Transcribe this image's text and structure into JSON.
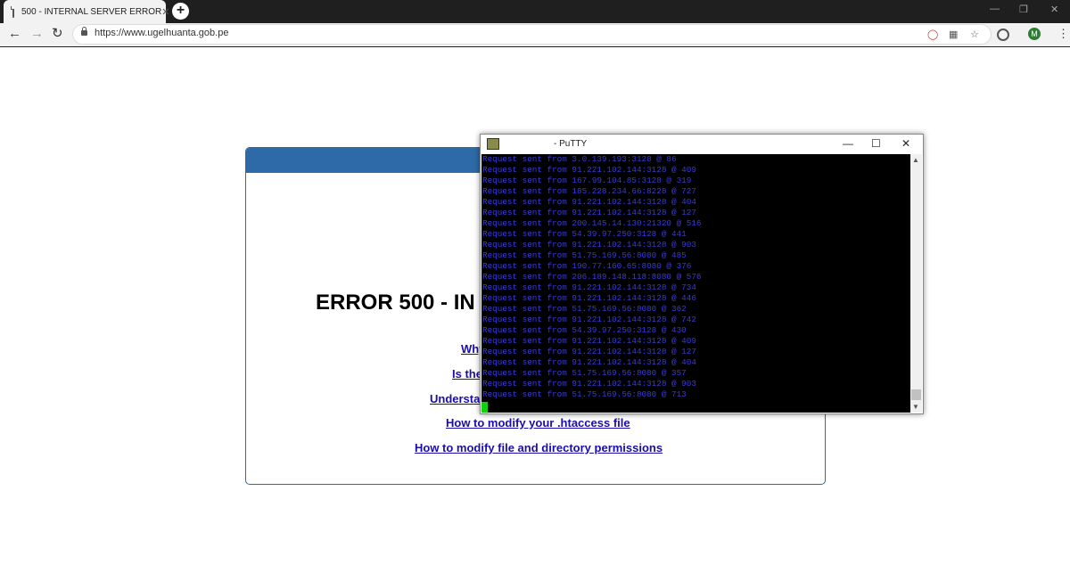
{
  "browser": {
    "tab_title": "500 - INTERNAL SERVER ERROR",
    "tab_close": "✕",
    "new_tab": "+",
    "url": "https://www.ugelhuanta.gob.pe",
    "profile_initial": "M"
  },
  "page": {
    "heading": "ERROR 500 - IN",
    "links": [
      "Why",
      "Is the",
      "Understa",
      "How to modify your .htaccess file",
      "How to modify file and directory permissions"
    ]
  },
  "putty": {
    "title": "- PuTTY",
    "lines": [
      "Request sent from 3.0.139.193:3128 @ 86",
      "Request sent from 91.221.102.144:3128 @ 409",
      "Request sent from 167.99.104.85:3128 @ 319",
      "Request sent from 185.228.234.66:8228 @ 727",
      "Request sent from 91.221.102.144:3128 @ 404",
      "Request sent from 91.221.102.144:3128 @ 127",
      "Request sent from 200.145.14.130:21320 @ 516",
      "Request sent from 54.39.97.250:3128 @ 441",
      "Request sent from 91.221.102.144:3128 @ 903",
      "Request sent from 51.75.169.56:8080 @ 485",
      "Request sent from 190.77.160.65:8080 @ 376",
      "Request sent from 206.189.148.118:8080 @ 576",
      "Request sent from 91.221.102.144:3128 @ 734",
      "Request sent from 91.221.102.144:3128 @ 446",
      "Request sent from 51.75.169.56:8080 @ 362",
      "Request sent from 91.221.102.144:3128 @ 742",
      "Request sent from 54.39.97.250:3128 @ 430",
      "Request sent from 91.221.102.144:3128 @ 409",
      "Request sent from 91.221.102.144:3128 @ 127",
      "Request sent from 91.221.102.144:3128 @ 404",
      "Request sent from 51.75.169.56:8080 @ 357",
      "Request sent from 91.221.102.144:3128 @ 903",
      "Request sent from 51.75.169.56:8080 @ 713"
    ]
  }
}
